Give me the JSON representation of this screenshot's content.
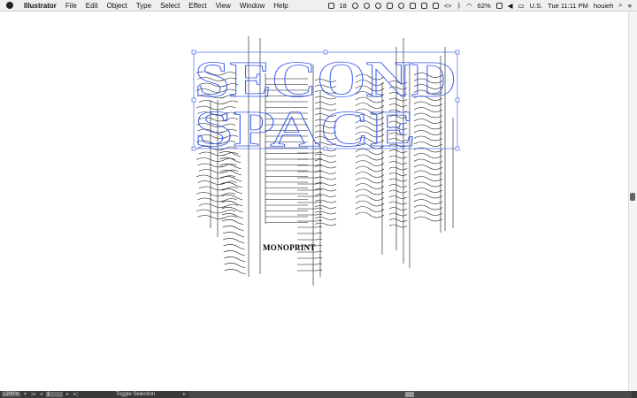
{
  "menubar": {
    "app": "Illustrator",
    "menus": [
      "File",
      "Edit",
      "Object",
      "Type",
      "Select",
      "Effect",
      "View",
      "Window",
      "Help"
    ],
    "status": {
      "badge_count": "18",
      "battery": "62%",
      "input": "U.S.",
      "clock": "Tue 11:11 PM",
      "user": "houieh"
    }
  },
  "artwork": {
    "title_line1": "SECOND",
    "title_line2": "SPACE",
    "caption": "MONOPRINT",
    "selection_color": "#3355ee"
  },
  "bottombar": {
    "zoom": "1200%",
    "page": "1",
    "status": "Toggle Selection"
  }
}
